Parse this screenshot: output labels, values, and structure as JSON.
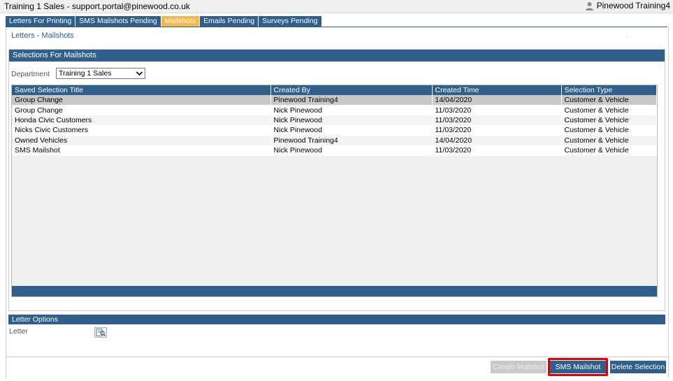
{
  "window": {
    "title": "Training 1 Sales - support.portal@pinewood.co.uk",
    "user": "Pinewood Training4"
  },
  "tabs": [
    {
      "label": "Letters For Printing",
      "active": false
    },
    {
      "label": "SMS Mailshots Pending",
      "active": false
    },
    {
      "label": "Mailshots",
      "active": true
    },
    {
      "label": "Emails Pending",
      "active": false
    },
    {
      "label": "Surveys Pending",
      "active": false
    }
  ],
  "breadcrumb": "Letters - Mailshots",
  "selections": {
    "header": "Selections For Mailshots",
    "department_label": "Department",
    "department_value": "Training 1 Sales",
    "columns": [
      "Saved Selection Title",
      "Created By",
      "Created Time",
      "Selection Type"
    ],
    "rows": [
      [
        "Group Change",
        "Pinewood Training4",
        "14/04/2020",
        "Customer & Vehicle"
      ],
      [
        "Group Change",
        "Nick Pinewood",
        "11/03/2020",
        "Customer & Vehicle"
      ],
      [
        "Honda Civic Customers",
        "Nick Pinewood",
        "11/03/2020",
        "Customer & Vehicle"
      ],
      [
        "Nicks Civic Customers",
        "Nick Pinewood",
        "11/03/2020",
        "Customer & Vehicle"
      ],
      [
        "Owned Vehicles",
        "Pinewood Training4",
        "14/04/2020",
        "Customer & Vehicle"
      ],
      [
        "SMS Mailshot",
        "Nick Pinewood",
        "11/03/2020",
        "Customer & Vehicle"
      ]
    ]
  },
  "letter_options": {
    "header": "Letter Options",
    "letter_label": "Letter"
  },
  "buttons": {
    "create": "Create Mailshot",
    "sms": "SMS Mailshot",
    "delete": "Delete Selection"
  },
  "colors": {
    "accent": "#2f5f8a",
    "active_tab": "#f2b84b",
    "highlight": "#e00000"
  }
}
